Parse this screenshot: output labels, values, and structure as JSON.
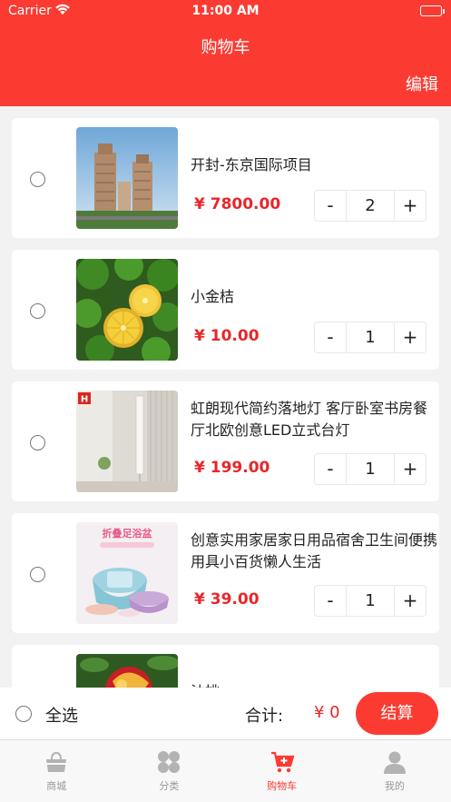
{
  "status_bar": {
    "carrier": "Carrier",
    "time": "11:00 AM"
  },
  "nav": {
    "title": "购物车",
    "edit": "编辑"
  },
  "items": [
    {
      "name": "开封-东京国际项目",
      "price": "¥ 7800.00",
      "qty": "2",
      "minus": "-",
      "plus": "+"
    },
    {
      "name": "小金桔",
      "price": "¥ 10.00",
      "qty": "1",
      "minus": "-",
      "plus": "+"
    },
    {
      "name": "虹朗现代简约落地灯 客厅卧室书房餐厅北欧创意LED立式台灯",
      "price": "¥ 199.00",
      "qty": "1",
      "minus": "-",
      "plus": "+",
      "thumb_badge": "H"
    },
    {
      "name": "创意实用家居家日用品宿舍卫生间便携用具小百货懒人生活",
      "price": "¥ 39.00",
      "qty": "1",
      "minus": "-",
      "plus": "+",
      "thumb_caption": "折叠足浴盆"
    },
    {
      "name": "油桃"
    }
  ],
  "footer": {
    "select_all": "全选",
    "total_label": "合计:",
    "total_value": "¥ 0",
    "checkout": "结算"
  },
  "tabs": [
    {
      "label": "商城",
      "icon": "basket-icon"
    },
    {
      "label": "分类",
      "icon": "category-icon"
    },
    {
      "label": "购物车",
      "icon": "cart-icon",
      "active": true
    },
    {
      "label": "我的",
      "icon": "profile-icon"
    }
  ],
  "colors": {
    "accent": "#fb3b32",
    "price": "#e8262a"
  }
}
